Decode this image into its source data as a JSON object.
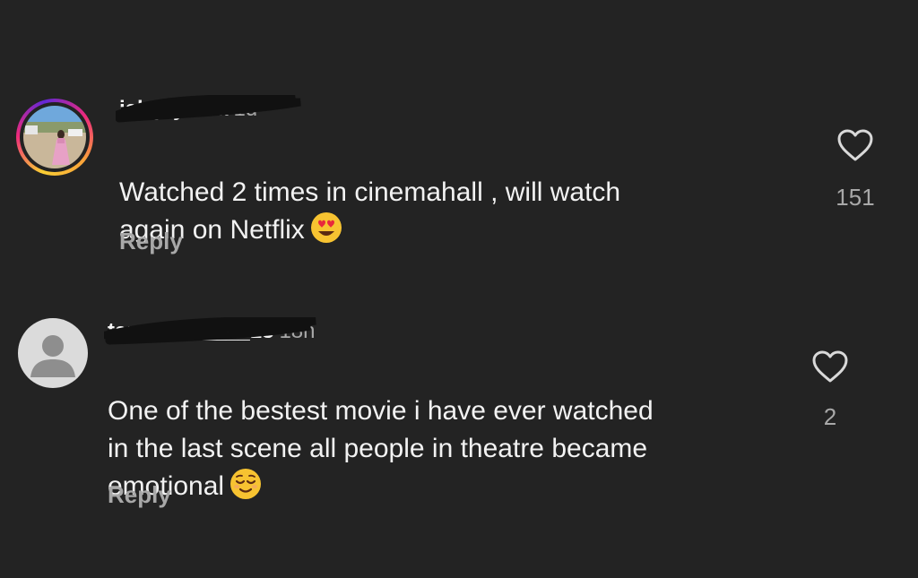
{
  "comments": [
    {
      "username": "jal_jayeeta",
      "time": "1d",
      "text": "Watched 2 times in cinemahall , will watch\nagain on  Netflix",
      "emoji": "heart-eyes-emoji",
      "reply_label": "Reply",
      "like_count": "151",
      "avatar": "story-ring-photo"
    },
    {
      "username": "tanushka____18",
      "time": "18h",
      "text": "One of the bestest movie i have ever watched\nin the last scene all people in theatre became\nemotional",
      "emoji": "relieved-face-emoji",
      "reply_label": "Reply",
      "like_count": "2",
      "avatar": "default-avatar"
    }
  ],
  "colors": {
    "background": "#232323",
    "text": "#f2f2f2",
    "secondary": "#a8a8a8"
  }
}
